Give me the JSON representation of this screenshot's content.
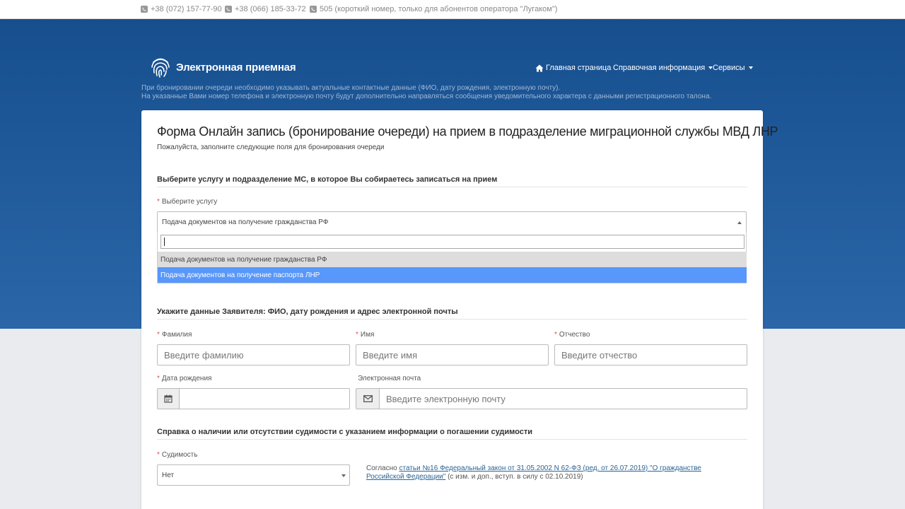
{
  "topbar": {
    "phone1": "+38 (072) 157-77-90",
    "phone2": "+38 (066) 185-33-72",
    "phone3": "505 (короткий номер, только для абонентов оператора \"Лугаком\")"
  },
  "header": {
    "logo_text": "Электронная приемная",
    "nav": {
      "home": "Главная страница",
      "reference": "Справочная информация",
      "services": "Сервисы"
    }
  },
  "info": {
    "line1": "При бронировании очереди необходимо указывать актуальные контактные данные (ФИО, дату рождения, электронную почту).",
    "line2": "На указанные Вами номер телефона и электронную почту будут дополнительно направляться сообщения уведомительного характера с данными регистрационного талона."
  },
  "form": {
    "title": "Форма Онлайн запись (бронирование очереди) на прием в подразделение миграционной службы МВД ЛНР",
    "subtitle": "Пожалуйста, заполните следующие поля для бронирования очереди",
    "section_service": "Выберите услугу и подразделение МС, в которое Вы собираетесь записаться на прием",
    "service_label": "Выберите услугу",
    "service_selected": "Подача документов на получение гражданства РФ",
    "dropdown_search_value": "",
    "dropdown_options": [
      "Подача документов на получение гражданства РФ",
      "Подача документов на получение паспорта ЛНР"
    ],
    "section_applicant": "Укажите данные Заявителя: ФИО, дату рождения и адрес электронной почты",
    "lastname_label": "Фамилия",
    "lastname_placeholder": "Введите фамилию",
    "firstname_label": "Имя",
    "firstname_placeholder": "Введите имя",
    "middlename_label": "Отчество",
    "middlename_placeholder": "Введите отчество",
    "birthdate_label": "Дата рождения",
    "birthdate_value": "",
    "email_label": "Электронная почта",
    "email_placeholder": "Введите электронную почту",
    "section_criminal": "Справка о наличии или отсутствии судимости с указанием информации о погашении судимости",
    "criminal_label": "Судимость",
    "criminal_value": "Нет",
    "note_prefix": "Согласно ",
    "note_link": "статьи №16 Федеральный закон от 31.05.2002 N 62-ФЗ (ред. от 26.07.2019) \"О гражданстве Российской Федерации\"",
    "note_suffix": " (с изм. и доп., вступ. в силу с 02.10.2019)",
    "required_mark": "*"
  },
  "colors": {
    "hero_top": "#174f8e",
    "hero_bottom": "#2a66a8",
    "highlight": "#5897fb",
    "required": "#d9534f",
    "link": "#2a6496"
  },
  "icons": [
    "phone-icon",
    "fingerprint-icon",
    "home-icon",
    "calendar-icon",
    "envelope-icon"
  ]
}
